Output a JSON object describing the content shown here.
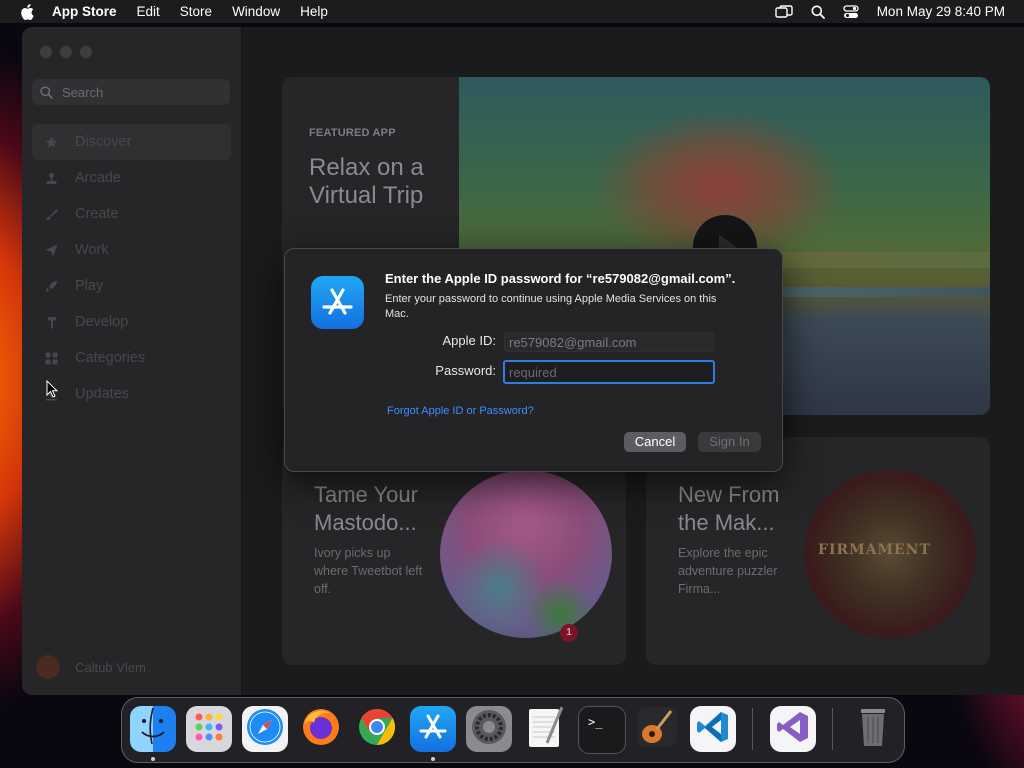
{
  "menubar": {
    "app_name": "App Store",
    "menus": [
      "Edit",
      "Store",
      "Window",
      "Help"
    ],
    "datetime": "Mon May 29  8:40 PM"
  },
  "sidebar": {
    "search_placeholder": "Search",
    "items": [
      {
        "label": "Discover",
        "icon": "star-icon",
        "active": true
      },
      {
        "label": "Arcade",
        "icon": "joystick-icon"
      },
      {
        "label": "Create",
        "icon": "brush-icon"
      },
      {
        "label": "Work",
        "icon": "paper-plane-icon"
      },
      {
        "label": "Play",
        "icon": "rocket-icon"
      },
      {
        "label": "Develop",
        "icon": "hammer-icon"
      },
      {
        "label": "Categories",
        "icon": "grid-icon"
      },
      {
        "label": "Updates",
        "icon": "download-icon"
      }
    ],
    "user_name": "Caltub Vlem"
  },
  "featured": {
    "label": "FEATURED APP",
    "title": "Relax on a Virtual Trip"
  },
  "cards": [
    {
      "title": "Tame Your Mastodo...",
      "description": "Ivory picks up where Tweetbot left off.",
      "badge": "1"
    },
    {
      "title": "New From the Mak...",
      "description": "Explore the epic adventure puzzler Firma...",
      "art_text": "FIRMAMENT"
    }
  ],
  "dialog": {
    "title": "Enter the Apple ID password for “re579082@gmail.com”.",
    "subtitle": "Enter your password to continue using Apple Media Services on this Mac.",
    "apple_id_label": "Apple ID:",
    "apple_id_value": "re579082@gmail.com",
    "password_label": "Password:",
    "password_placeholder": "required",
    "forgot_link": "Forgot Apple ID or Password?",
    "cancel_label": "Cancel",
    "signin_label": "Sign In"
  },
  "dock": {
    "apps": [
      "Finder",
      "Launchpad",
      "Safari",
      "Firefox",
      "Chrome",
      "App Store",
      "System Settings",
      "TextEdit",
      "Terminal",
      "GarageBand",
      "Visual Studio Code",
      "Visual Studio",
      "Trash"
    ],
    "running": [
      "Finder",
      "App Store"
    ]
  },
  "colors": {
    "accent": "#2f7de3",
    "link": "#3e8eff",
    "appstore_icon": "#1b8cf0"
  }
}
